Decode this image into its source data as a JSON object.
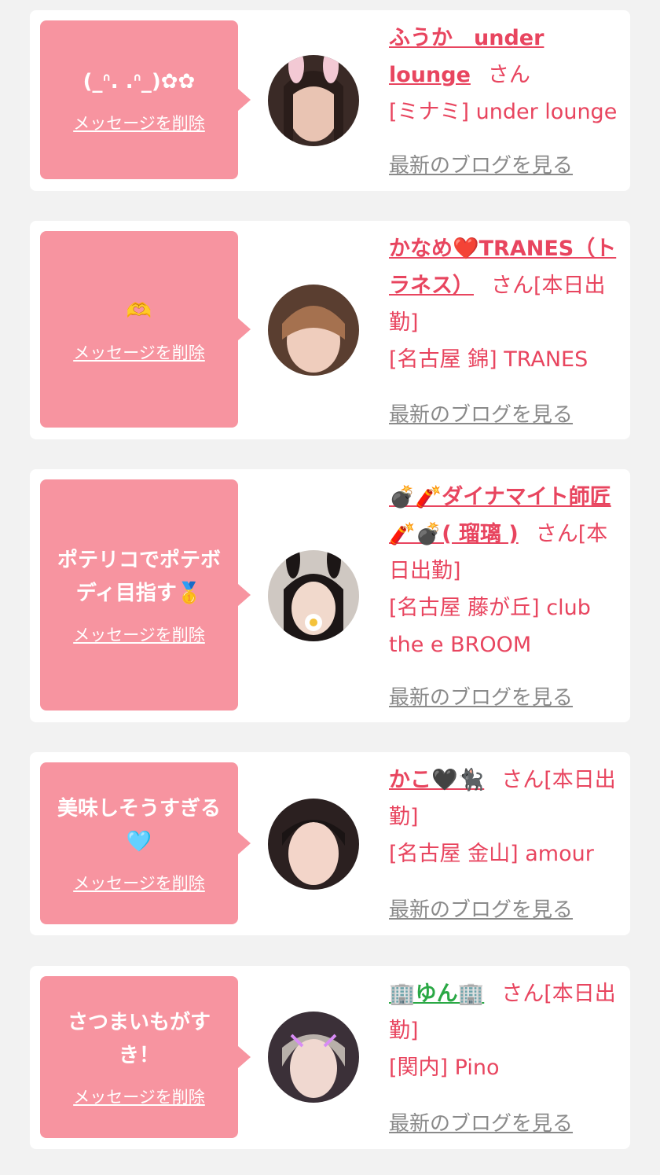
{
  "colors": {
    "accent": "#e8455f",
    "bubble": "#f794a0",
    "link_gray": "#8a8a8a"
  },
  "delete_label": "メッセージを削除",
  "blog_label": "最新のブログを見る",
  "cards": [
    {
      "message": "(_ᐢ. .ᐢ_)✿✿",
      "name": "ふうか　under lounge",
      "suffix": "さん",
      "shop": "[ミナミ] under lounge"
    },
    {
      "message": "🫶",
      "name": "かなめ❤️TRANES（トラネス）",
      "suffix": "さん[本日出勤]",
      "shop": "[名古屋 錦] TRANES"
    },
    {
      "message": "ポテリコでポテボディ目指す🥇",
      "name": "💣🧨ダイナマイト師匠🧨💣( 瑠璃 )",
      "suffix": "さん[本日出勤]",
      "shop": "[名古屋 藤が丘] club the e BROOM"
    },
    {
      "message": "美味しそうすぎる🩵",
      "name": "かこ🖤🐈‍⬛",
      "suffix": "さん[本日出勤]",
      "shop": "[名古屋 金山] amour"
    },
    {
      "message": "さつまいもがすき！",
      "name": "🏢ゆん🏢",
      "suffix": "さん[本日出勤]",
      "shop": "[関内] Pino"
    }
  ]
}
